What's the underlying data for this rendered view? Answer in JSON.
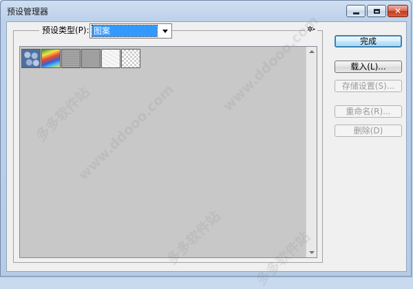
{
  "window": {
    "title": "预设管理器",
    "controls": {
      "minimize_icon": "minimize-icon",
      "maximize_icon": "maximize-icon",
      "close_icon": "close-icon",
      "close_glyph": "✕"
    }
  },
  "preset": {
    "type_label": "预设类型(P):",
    "selected_type": "图案",
    "menu_glyph": "✲"
  },
  "thumbnails": [
    {
      "name": "blue-bubbles"
    },
    {
      "name": "rainbow"
    },
    {
      "name": "gray-texture-1"
    },
    {
      "name": "gray-texture-2"
    },
    {
      "name": "white-texture"
    },
    {
      "name": "transparent-checker"
    }
  ],
  "buttons": {
    "done": "完成",
    "load": "载入(L)...",
    "save": "存储设置(S)...",
    "rename": "重命名(R)...",
    "delete": "删除(D)"
  },
  "watermark": {
    "text_cn": "多多软件站",
    "text_url": "www.ddooo.com"
  },
  "colors": {
    "selection": "#3399ff",
    "panel_bg": "#c8c8c8",
    "default_button_border": "#3c7fb1"
  }
}
